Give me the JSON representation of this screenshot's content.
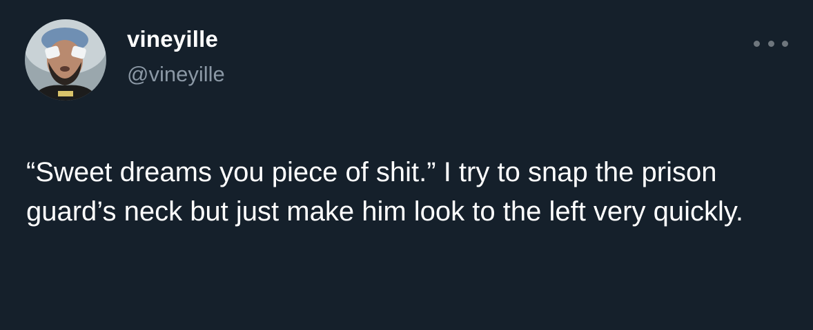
{
  "author": {
    "display_name": "vineyille",
    "handle": "@vineyille"
  },
  "avatar": {
    "icon": "profile-photo-avatar"
  },
  "more_menu": {
    "icon": "ellipsis-icon"
  },
  "tweet": {
    "text": "“Sweet dreams you piece of shit.” I try to snap the prison guard’s neck but just make him look to the left very quickly."
  },
  "colors": {
    "background": "#15202b",
    "primary_text": "#ffffff",
    "secondary_text": "#8b98a5",
    "icon": "#6e767d"
  }
}
